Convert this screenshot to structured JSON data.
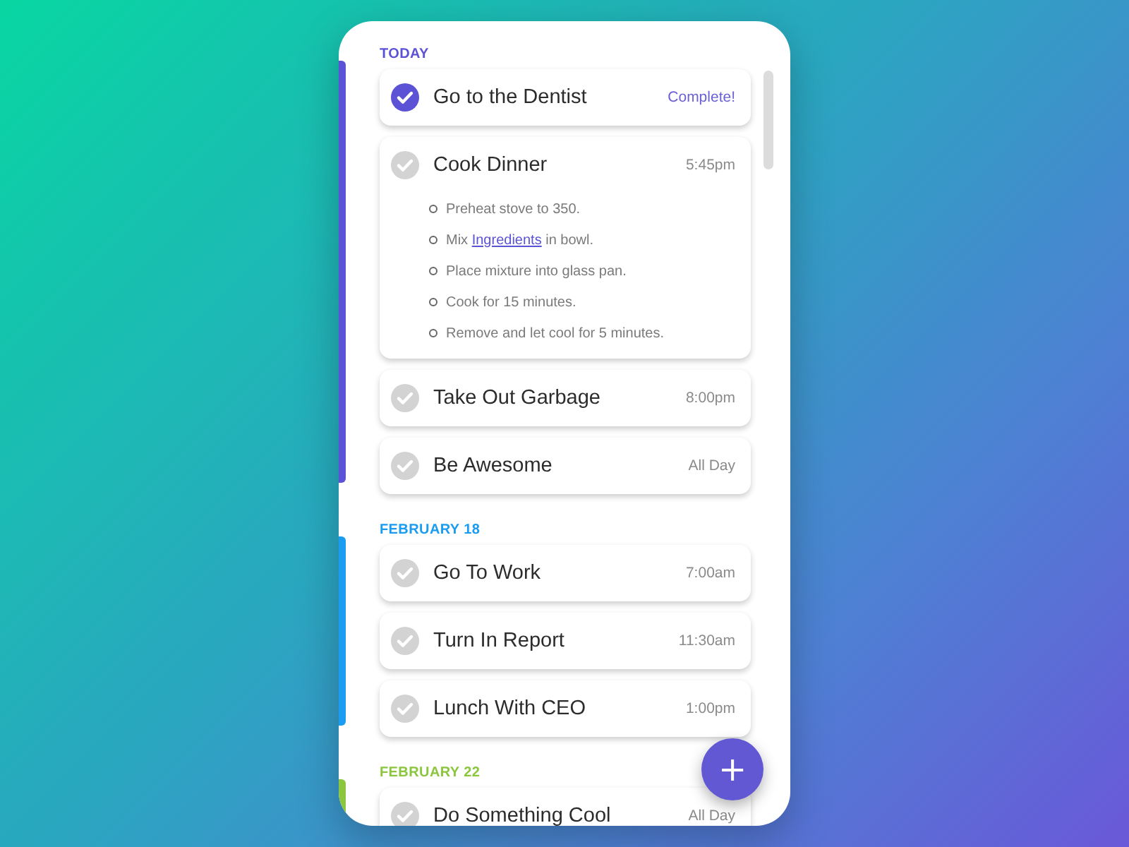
{
  "sections": [
    {
      "label": "TODAY",
      "color": "#5b52d6",
      "items": [
        {
          "title": "Go to the Dentist",
          "time": "Complete!",
          "done": true
        },
        {
          "title": "Cook Dinner",
          "time": "5:45pm",
          "done": false,
          "steps": [
            {
              "text": "Preheat stove to 350."
            },
            {
              "text": "Mix ",
              "link": "Ingredients",
              "after": " in bowl."
            },
            {
              "text": "Place mixture into glass pan."
            },
            {
              "text": "Cook for 15 minutes."
            },
            {
              "text": "Remove and let cool for 5 minutes."
            }
          ]
        },
        {
          "title": "Take Out Garbage",
          "time": "8:00pm",
          "done": false
        },
        {
          "title": "Be Awesome",
          "time": "All Day",
          "done": false
        }
      ]
    },
    {
      "label": "FEBRUARY 18",
      "color": "#1a9cf0",
      "items": [
        {
          "title": "Go To Work",
          "time": "7:00am",
          "done": false
        },
        {
          "title": "Turn In Report",
          "time": "11:30am",
          "done": false
        },
        {
          "title": "Lunch With CEO",
          "time": "1:00pm",
          "done": false
        }
      ]
    },
    {
      "label": "FEBRUARY 22",
      "color": "#8cc63f",
      "items": [
        {
          "title": "Do Something Cool",
          "time": "All Day",
          "done": false
        }
      ]
    }
  ],
  "fab": {
    "label": "+"
  }
}
